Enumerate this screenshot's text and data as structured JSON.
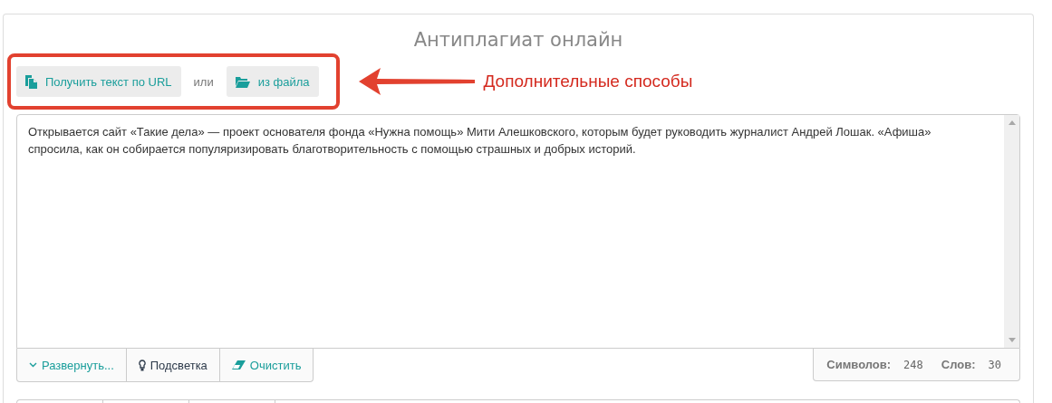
{
  "title": "Антиплагиат онлайн",
  "source_buttons": [
    {
      "kind": "url",
      "label": "Получить текст по URL"
    },
    {
      "kind": "file",
      "label": "из файла"
    }
  ],
  "or_text": "или",
  "annotation": {
    "label": "Дополнительные способы"
  },
  "editor": {
    "value": "Открывается сайт «Такие дела» — проект основателя фонда «Нужна помощь» Мити Алешковского, которым будет руководить журналист Андрей Лошак. «Афиша» спросила, как он собирается популяризировать благотворительность с помощью страшных и добрых историй."
  },
  "toolbar": [
    {
      "kind": "expand",
      "label": "Развернуть..."
    },
    {
      "kind": "highlight",
      "label": "Подсветка"
    },
    {
      "kind": "clear",
      "label": "Очистить"
    }
  ],
  "stats": [
    {
      "label": "Символов:",
      "value": "248"
    },
    {
      "label": "Слов:",
      "value": "30"
    }
  ]
}
